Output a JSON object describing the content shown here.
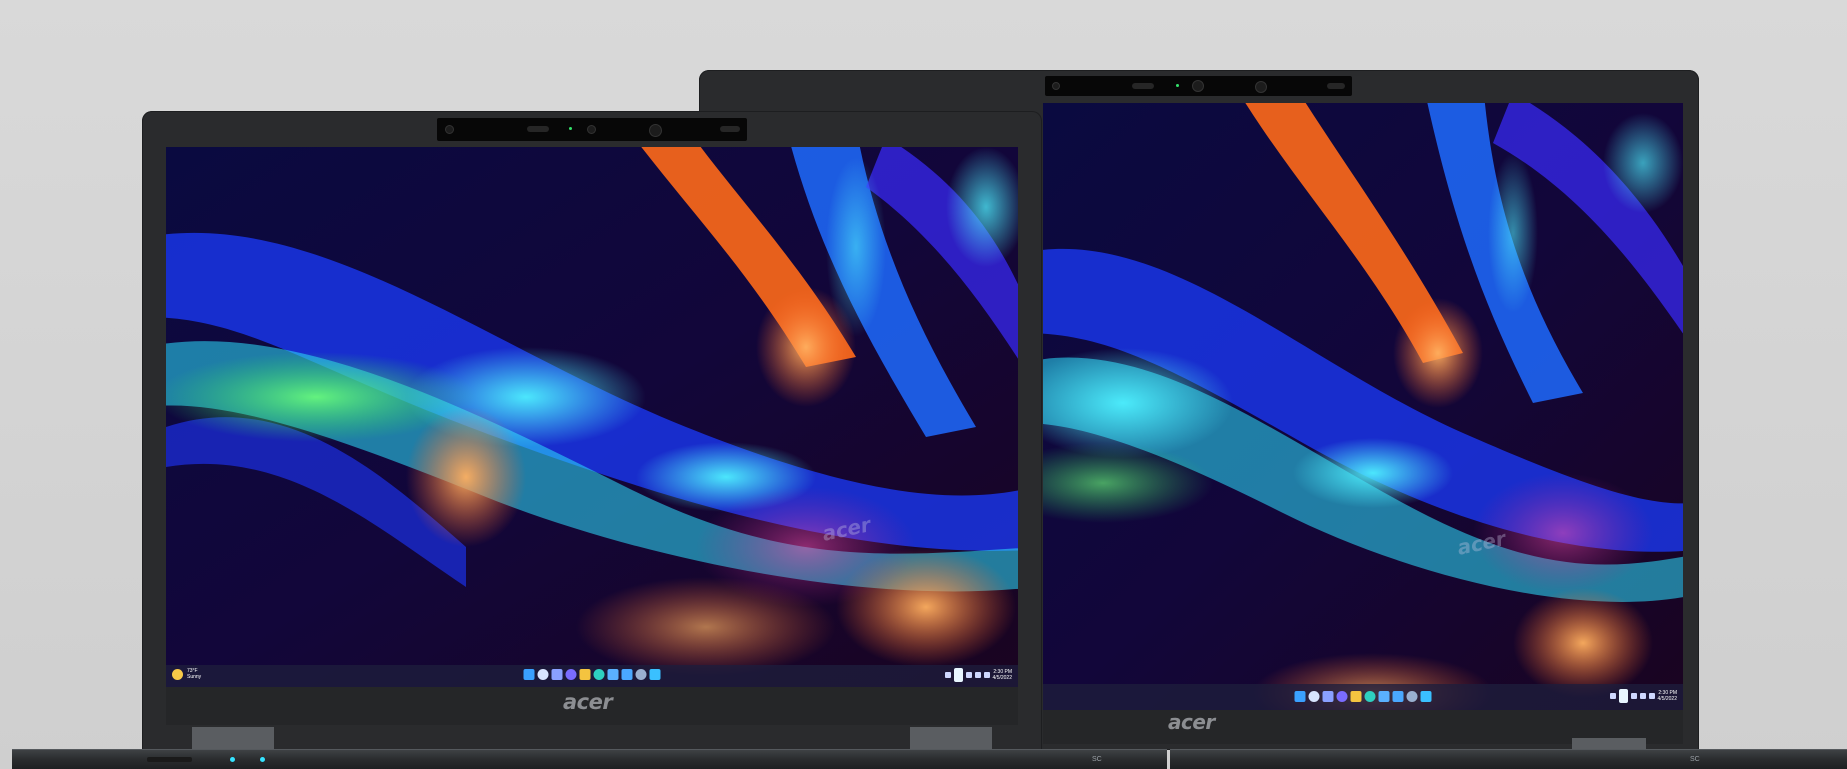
{
  "brand": "acer",
  "screen_watermark": "acer",
  "taskbar": {
    "weather_temp": "73°F",
    "weather_text": "Sunny",
    "time": "2:30 PM",
    "date": "4/5/2022"
  },
  "base_label": "SC",
  "icons": {
    "webcam": "webcam-icon",
    "weather": "sun-icon",
    "start": "windows-start-icon",
    "search": "search-icon"
  },
  "colors": {
    "background": "#d5d5d5",
    "bezel": "#2a2b2d",
    "accent_cyan": "#14d8ff",
    "accent_orange": "#ff7a2a",
    "accent_green": "#3cff8a"
  }
}
